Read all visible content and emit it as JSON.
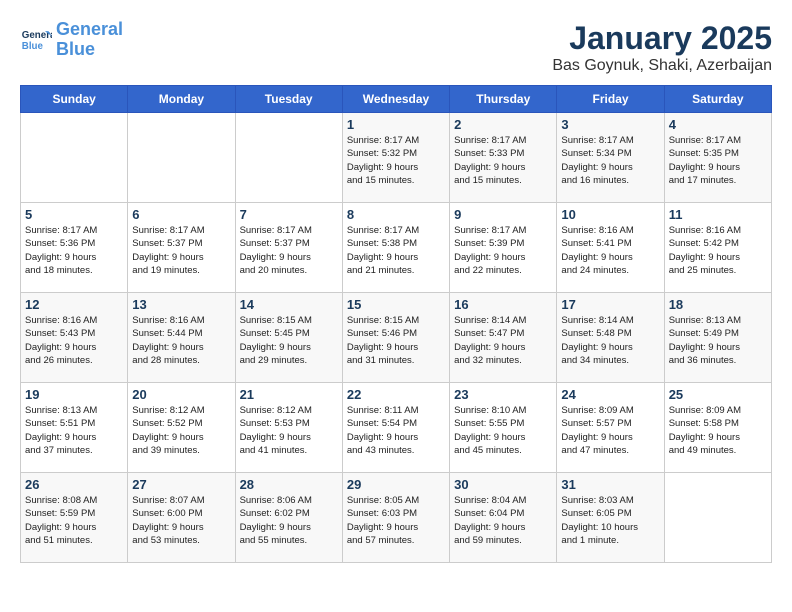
{
  "header": {
    "logo_line1": "General",
    "logo_line2": "Blue",
    "title": "January 2025",
    "subtitle": "Bas Goynuk, Shaki, Azerbaijan"
  },
  "weekdays": [
    "Sunday",
    "Monday",
    "Tuesday",
    "Wednesday",
    "Thursday",
    "Friday",
    "Saturday"
  ],
  "weeks": [
    [
      {
        "day": "",
        "info": ""
      },
      {
        "day": "",
        "info": ""
      },
      {
        "day": "",
        "info": ""
      },
      {
        "day": "1",
        "info": "Sunrise: 8:17 AM\nSunset: 5:32 PM\nDaylight: 9 hours\nand 15 minutes."
      },
      {
        "day": "2",
        "info": "Sunrise: 8:17 AM\nSunset: 5:33 PM\nDaylight: 9 hours\nand 15 minutes."
      },
      {
        "day": "3",
        "info": "Sunrise: 8:17 AM\nSunset: 5:34 PM\nDaylight: 9 hours\nand 16 minutes."
      },
      {
        "day": "4",
        "info": "Sunrise: 8:17 AM\nSunset: 5:35 PM\nDaylight: 9 hours\nand 17 minutes."
      }
    ],
    [
      {
        "day": "5",
        "info": "Sunrise: 8:17 AM\nSunset: 5:36 PM\nDaylight: 9 hours\nand 18 minutes."
      },
      {
        "day": "6",
        "info": "Sunrise: 8:17 AM\nSunset: 5:37 PM\nDaylight: 9 hours\nand 19 minutes."
      },
      {
        "day": "7",
        "info": "Sunrise: 8:17 AM\nSunset: 5:37 PM\nDaylight: 9 hours\nand 20 minutes."
      },
      {
        "day": "8",
        "info": "Sunrise: 8:17 AM\nSunset: 5:38 PM\nDaylight: 9 hours\nand 21 minutes."
      },
      {
        "day": "9",
        "info": "Sunrise: 8:17 AM\nSunset: 5:39 PM\nDaylight: 9 hours\nand 22 minutes."
      },
      {
        "day": "10",
        "info": "Sunrise: 8:16 AM\nSunset: 5:41 PM\nDaylight: 9 hours\nand 24 minutes."
      },
      {
        "day": "11",
        "info": "Sunrise: 8:16 AM\nSunset: 5:42 PM\nDaylight: 9 hours\nand 25 minutes."
      }
    ],
    [
      {
        "day": "12",
        "info": "Sunrise: 8:16 AM\nSunset: 5:43 PM\nDaylight: 9 hours\nand 26 minutes."
      },
      {
        "day": "13",
        "info": "Sunrise: 8:16 AM\nSunset: 5:44 PM\nDaylight: 9 hours\nand 28 minutes."
      },
      {
        "day": "14",
        "info": "Sunrise: 8:15 AM\nSunset: 5:45 PM\nDaylight: 9 hours\nand 29 minutes."
      },
      {
        "day": "15",
        "info": "Sunrise: 8:15 AM\nSunset: 5:46 PM\nDaylight: 9 hours\nand 31 minutes."
      },
      {
        "day": "16",
        "info": "Sunrise: 8:14 AM\nSunset: 5:47 PM\nDaylight: 9 hours\nand 32 minutes."
      },
      {
        "day": "17",
        "info": "Sunrise: 8:14 AM\nSunset: 5:48 PM\nDaylight: 9 hours\nand 34 minutes."
      },
      {
        "day": "18",
        "info": "Sunrise: 8:13 AM\nSunset: 5:49 PM\nDaylight: 9 hours\nand 36 minutes."
      }
    ],
    [
      {
        "day": "19",
        "info": "Sunrise: 8:13 AM\nSunset: 5:51 PM\nDaylight: 9 hours\nand 37 minutes."
      },
      {
        "day": "20",
        "info": "Sunrise: 8:12 AM\nSunset: 5:52 PM\nDaylight: 9 hours\nand 39 minutes."
      },
      {
        "day": "21",
        "info": "Sunrise: 8:12 AM\nSunset: 5:53 PM\nDaylight: 9 hours\nand 41 minutes."
      },
      {
        "day": "22",
        "info": "Sunrise: 8:11 AM\nSunset: 5:54 PM\nDaylight: 9 hours\nand 43 minutes."
      },
      {
        "day": "23",
        "info": "Sunrise: 8:10 AM\nSunset: 5:55 PM\nDaylight: 9 hours\nand 45 minutes."
      },
      {
        "day": "24",
        "info": "Sunrise: 8:09 AM\nSunset: 5:57 PM\nDaylight: 9 hours\nand 47 minutes."
      },
      {
        "day": "25",
        "info": "Sunrise: 8:09 AM\nSunset: 5:58 PM\nDaylight: 9 hours\nand 49 minutes."
      }
    ],
    [
      {
        "day": "26",
        "info": "Sunrise: 8:08 AM\nSunset: 5:59 PM\nDaylight: 9 hours\nand 51 minutes."
      },
      {
        "day": "27",
        "info": "Sunrise: 8:07 AM\nSunset: 6:00 PM\nDaylight: 9 hours\nand 53 minutes."
      },
      {
        "day": "28",
        "info": "Sunrise: 8:06 AM\nSunset: 6:02 PM\nDaylight: 9 hours\nand 55 minutes."
      },
      {
        "day": "29",
        "info": "Sunrise: 8:05 AM\nSunset: 6:03 PM\nDaylight: 9 hours\nand 57 minutes."
      },
      {
        "day": "30",
        "info": "Sunrise: 8:04 AM\nSunset: 6:04 PM\nDaylight: 9 hours\nand 59 minutes."
      },
      {
        "day": "31",
        "info": "Sunrise: 8:03 AM\nSunset: 6:05 PM\nDaylight: 10 hours\nand 1 minute."
      },
      {
        "day": "",
        "info": ""
      }
    ]
  ]
}
